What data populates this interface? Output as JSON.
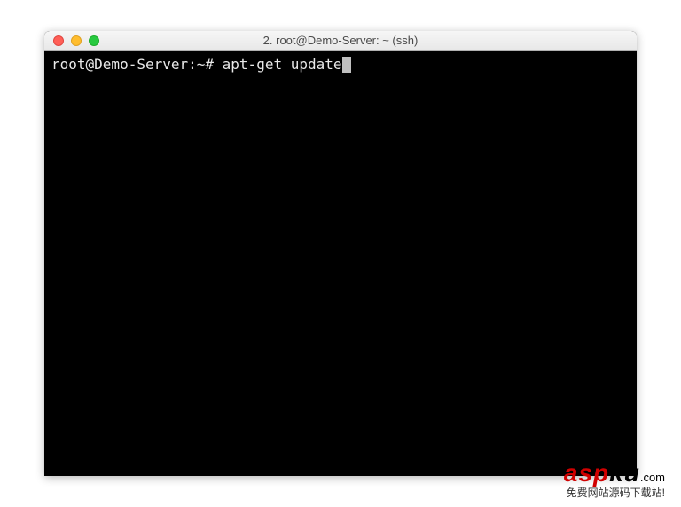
{
  "window": {
    "title": "2. root@Demo-Server: ~ (ssh)"
  },
  "terminal": {
    "prompt": "root@Demo-Server:~# ",
    "command": "apt-get update"
  },
  "traffic_lights": {
    "close": "close",
    "minimize": "minimize",
    "maximize": "maximize"
  },
  "watermark": {
    "prefix": "asp",
    "suffix": "ku",
    "tld": ".com",
    "subtitle": "免费网站源码下载站!"
  }
}
